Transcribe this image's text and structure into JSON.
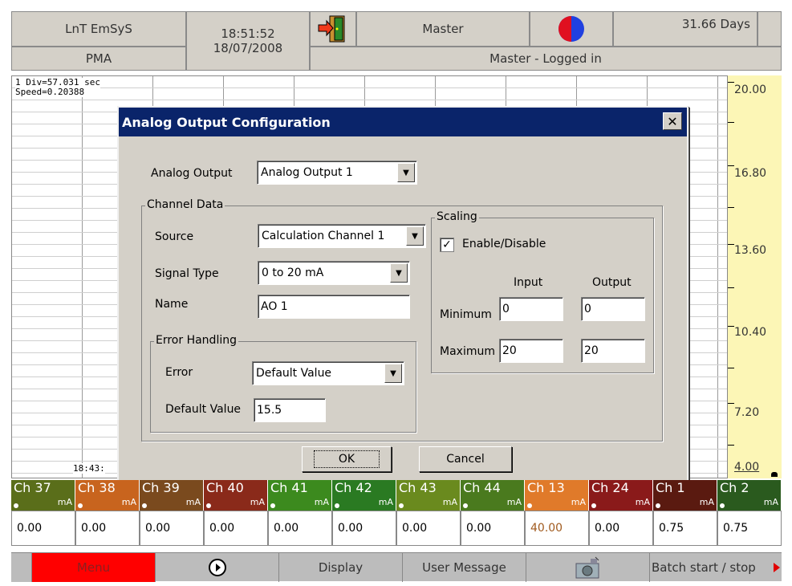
{
  "header": {
    "app_name": "LnT EmSyS",
    "sub_name": "PMA",
    "time": "18:51:52",
    "date": "18/07/2008",
    "user": "Master",
    "status": "Master - Logged in",
    "days": "31.66 Days"
  },
  "chart": {
    "div_info": "1 Div=57.031 sec",
    "speed_info": "Speed=0.20388",
    "time_label": "18:43:",
    "scale_labels": [
      "20.00",
      "16.80",
      "13.60",
      "10.40",
      "7.20",
      "4.00"
    ],
    "scale_color": "#fcf6b6"
  },
  "dialog": {
    "title": "Analog Output Configuration",
    "analog_output_label": "Analog Output",
    "analog_output_value": "Analog Output 1",
    "channel_data_title": "Channel Data",
    "source_label": "Source",
    "source_value": "Calculation Channel 1",
    "signal_type_label": "Signal Type",
    "signal_type_value": "0 to 20 mA",
    "name_label": "Name",
    "name_value": "AO 1",
    "error_handling_title": "Error Handling",
    "error_label": "Error",
    "error_value": "Default Value",
    "default_value_label": "Default Value",
    "default_value_value": "15.5",
    "scaling_title": "Scaling",
    "enable_label": "Enable/Disable",
    "enable_checked": true,
    "input_header": "Input",
    "output_header": "Output",
    "minimum_label": "Minimum",
    "maximum_label": "Maximum",
    "min_input": "0",
    "min_output": "0",
    "max_input": "20",
    "max_output": "20",
    "ok_label": "OK",
    "cancel_label": "Cancel",
    "titlebar_color": "#0a246a"
  },
  "channels": [
    {
      "name": "Ch 37",
      "unit": "mA",
      "value": "0.00",
      "color": "#5a6e1a"
    },
    {
      "name": "Ch 38",
      "unit": "mA",
      "value": "0.00",
      "color": "#c8641e"
    },
    {
      "name": "Ch 39",
      "unit": "mA",
      "value": "0.00",
      "color": "#7a4a1e"
    },
    {
      "name": "Ch 40",
      "unit": "mA",
      "value": "0.00",
      "color": "#8a2a1a"
    },
    {
      "name": "Ch 41",
      "unit": "mA",
      "value": "0.00",
      "color": "#3c8a1e"
    },
    {
      "name": "Ch 42",
      "unit": "mA",
      "value": "0.00",
      "color": "#2a7a22"
    },
    {
      "name": "Ch 43",
      "unit": "mA",
      "value": "0.00",
      "color": "#6a8a1e"
    },
    {
      "name": "Ch 44",
      "unit": "mA",
      "value": "0.00",
      "color": "#4a7a1e"
    },
    {
      "name": "Ch 13",
      "unit": "mA",
      "value": "40.00",
      "value_color": "#a05a1e",
      "color": "#e07a2a"
    },
    {
      "name": "Ch 24",
      "unit": "mA",
      "value": "0.00",
      "color": "#8a1a1a"
    },
    {
      "name": "Ch 1",
      "unit": "mA",
      "value": "0.75",
      "color": "#5a1a10"
    },
    {
      "name": "Ch 2",
      "unit": "mA",
      "value": "0.75",
      "color": "#2a5a1e"
    }
  ],
  "bottom_bar": {
    "menu_label": "Menu",
    "display_label": "Display",
    "user_message_label": "User Message",
    "batch_label": "Batch start / stop",
    "menu_color": "#ff0000"
  }
}
